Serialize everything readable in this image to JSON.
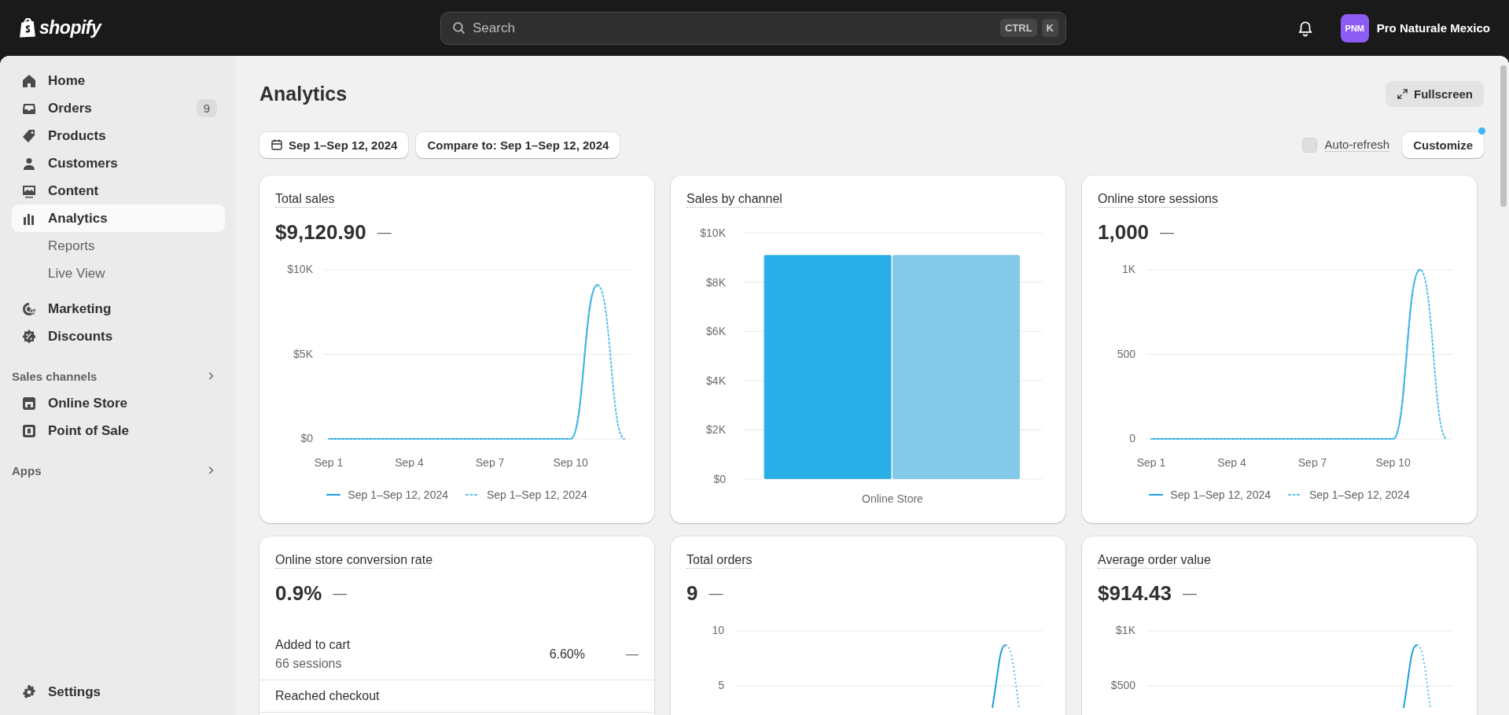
{
  "topbar": {
    "logo": "shopify",
    "search": {
      "placeholder": "Search",
      "shortcut": [
        "CTRL",
        "K"
      ]
    },
    "store": {
      "initials": "PNM",
      "name": "Pro Naturale Mexico"
    }
  },
  "sidebar": {
    "items": [
      {
        "label": "Home",
        "selected": false
      },
      {
        "label": "Orders",
        "badge": "9",
        "selected": false
      },
      {
        "label": "Products",
        "selected": false
      },
      {
        "label": "Customers",
        "selected": false
      },
      {
        "label": "Content",
        "selected": false
      },
      {
        "label": "Analytics",
        "selected": true,
        "children": [
          {
            "label": "Reports",
            "selected": false
          },
          {
            "label": "Live View",
            "selected": false
          }
        ]
      },
      {
        "label": "Marketing",
        "selected": false
      },
      {
        "label": "Discounts",
        "selected": false
      }
    ],
    "sections": [
      {
        "title": "Sales channels",
        "items": [
          {
            "label": "Online Store",
            "selected": false
          },
          {
            "label": "Point of Sale",
            "selected": false
          }
        ]
      },
      {
        "title": "Apps"
      }
    ],
    "settings": "Settings"
  },
  "page": {
    "title": "Analytics",
    "fullscreen": "Fullscreen",
    "date_range": "Sep 1–Sep 12, 2024",
    "compare": "Compare to: Sep 1–Sep 12, 2024",
    "auto_refresh": {
      "label": "Auto-refresh",
      "checked": false
    },
    "customize": {
      "label": "Customize",
      "notification_dot": true
    }
  },
  "cards": [
    {
      "kind": "chart",
      "title": "Total sales",
      "value": "$9,120.90",
      "change": "—",
      "chart_data": {
        "type": "line",
        "grid": true,
        "categories": [
          "Sep 1",
          null,
          null,
          "Sep 4",
          null,
          null,
          "Sep 7",
          null,
          null,
          "Sep 10",
          null,
          null
        ],
        "ylim": [
          0,
          10000
        ],
        "yticks": [
          {
            "value": 0,
            "label": "$0"
          },
          {
            "value": 5000,
            "label": "$5K"
          },
          {
            "value": 10000,
            "label": "$10K"
          }
        ],
        "series": [
          {
            "name": "Sep 1–Sep 12, 2024",
            "color": "#1a9fdc",
            "line_style": "solid",
            "values": [
              0,
              0,
              0,
              0,
              0,
              0,
              0,
              0,
              0,
              0,
              9100,
              null
            ]
          },
          {
            "name": "Sep 1–Sep 12, 2024",
            "color": "#5cc0ec",
            "line_style": "dotted",
            "values": [
              0,
              0,
              0,
              0,
              0,
              0,
              0,
              0,
              0,
              0,
              9100,
              0
            ]
          }
        ]
      }
    },
    {
      "kind": "chart",
      "title": "Sales by channel",
      "chart_data": {
        "type": "bar",
        "grid": true,
        "categories": [
          "Online Store"
        ],
        "ylim": [
          0,
          10000
        ],
        "yticks": [
          {
            "value": 0,
            "label": "$0"
          },
          {
            "value": 2000,
            "label": "$2K"
          },
          {
            "value": 4000,
            "label": "$4K"
          },
          {
            "value": 6000,
            "label": "$6K"
          },
          {
            "value": 8000,
            "label": "$8K"
          },
          {
            "value": 10000,
            "label": "$10K"
          }
        ],
        "series": [
          {
            "color": "#2aaee8",
            "values": [
              9100
            ]
          },
          {
            "color": "#83c9e8",
            "values": [
              9100
            ]
          }
        ]
      }
    },
    {
      "kind": "chart",
      "title": "Online store sessions",
      "value": "1,000",
      "change": "—",
      "chart_data": {
        "type": "line",
        "grid": true,
        "categories": [
          "Sep 1",
          null,
          null,
          "Sep 4",
          null,
          null,
          "Sep 7",
          null,
          null,
          "Sep 10",
          null,
          null
        ],
        "ylim": [
          0,
          1000
        ],
        "yticks": [
          {
            "value": 0,
            "label": "0"
          },
          {
            "value": 500,
            "label": "500"
          },
          {
            "value": 1000,
            "label": "1K"
          }
        ],
        "series": [
          {
            "name": "Sep 1–Sep 12, 2024",
            "color": "#1a9fdc",
            "line_style": "solid",
            "values": [
              0,
              0,
              0,
              0,
              0,
              0,
              0,
              0,
              0,
              0,
              1000,
              null
            ]
          },
          {
            "name": "Sep 1–Sep 12, 2024",
            "color": "#5cc0ec",
            "line_style": "dotted",
            "values": [
              0,
              0,
              0,
              0,
              0,
              0,
              0,
              0,
              0,
              0,
              1000,
              0
            ]
          }
        ]
      }
    },
    {
      "kind": "funnel",
      "title": "Online store conversion rate",
      "value": "0.9%",
      "change": "—",
      "rows": [
        {
          "label": "Added to cart",
          "detail": "66 sessions",
          "rate": "6.60%",
          "change": "—"
        },
        {
          "label": "Reached checkout"
        }
      ]
    },
    {
      "kind": "chart_preview",
      "title": "Total orders",
      "value": "9",
      "change": "—",
      "axis_labels": [
        "10",
        "5"
      ]
    },
    {
      "kind": "chart_preview",
      "title": "Average order value",
      "value": "$914.43",
      "change": "—",
      "axis_labels": [
        "$1K",
        "$500"
      ]
    }
  ]
}
